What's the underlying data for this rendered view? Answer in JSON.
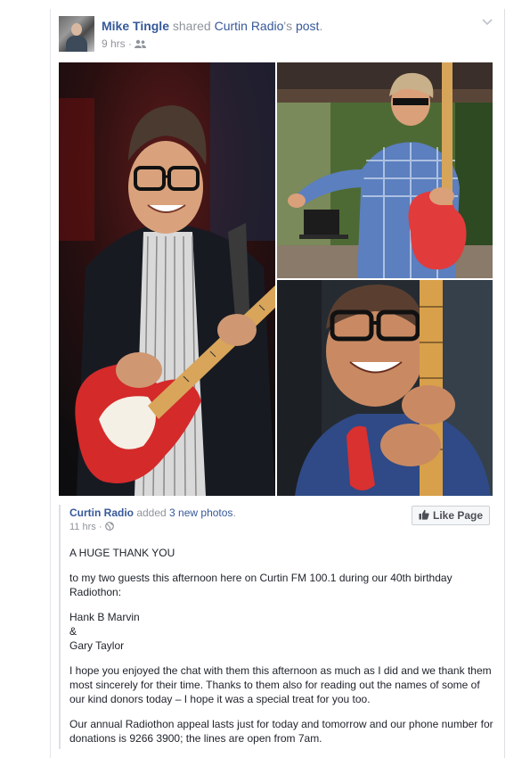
{
  "post": {
    "author": "Mike Tingle",
    "shared_text": " shared ",
    "page_name": "Curtin Radio",
    "possessive": "'s ",
    "post_word": "post",
    "period": ".",
    "time": "9 hrs",
    "sep": " · ",
    "audience_icon": "friends-icon",
    "menu_icon": "chevron-down-icon"
  },
  "photos": [
    {
      "label": "photo-1"
    },
    {
      "label": "photo-2"
    },
    {
      "label": "photo-3"
    }
  ],
  "shared": {
    "page_name": "Curtin Radio",
    "added_text": " added ",
    "photos_link": "3 new photos",
    "period": ".",
    "time": "11 hrs",
    "sep": " · ",
    "audience_icon": "globe-icon",
    "like_page_label": "Like Page",
    "like_icon": "thumbs-up-icon"
  },
  "text": {
    "line1": "A HUGE THANK YOU",
    "line2": "to my two guests this afternoon here on Curtin FM 100.1 during our 40th birthday Radiothon:",
    "line3a": "Hank B Marvin",
    "line3b": "&",
    "line3c": "Gary Taylor",
    "line4": "I hope you enjoyed the chat with them this afternoon as much as I did and we thank them most sincerely for their time. Thanks to them also for reading out the names of some of our kind donors today – I hope it was a special treat for you too.",
    "line5": "Our annual Radiothon appeal lasts just for today and tomorrow and our phone number for donations is 9266 3900; the lines are open from 7am."
  },
  "colors": {
    "link": "#365899",
    "meta": "#90949c",
    "text": "#1d2129"
  }
}
